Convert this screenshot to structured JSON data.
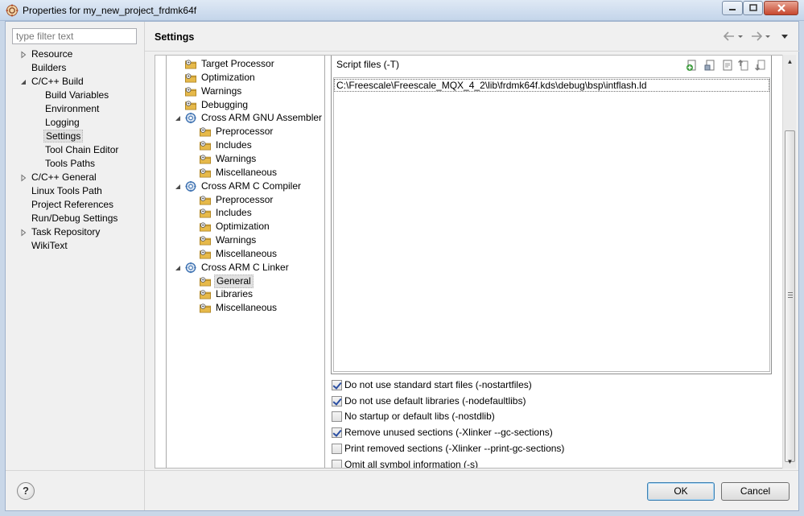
{
  "window": {
    "title": "Properties for my_new_project_frdmk64f",
    "controls": [
      "minimize",
      "maximize",
      "close"
    ]
  },
  "filter": {
    "placeholder": "type filter text"
  },
  "nav": {
    "items": [
      {
        "label": "Resource",
        "level": 0,
        "twisty": "collapsed"
      },
      {
        "label": "Builders",
        "level": 0,
        "twisty": "none"
      },
      {
        "label": "C/C++ Build",
        "level": 0,
        "twisty": "expanded"
      },
      {
        "label": "Build Variables",
        "level": 1,
        "twisty": "none"
      },
      {
        "label": "Environment",
        "level": 1,
        "twisty": "none"
      },
      {
        "label": "Logging",
        "level": 1,
        "twisty": "none"
      },
      {
        "label": "Settings",
        "level": 1,
        "twisty": "none",
        "selected": true
      },
      {
        "label": "Tool Chain Editor",
        "level": 1,
        "twisty": "none"
      },
      {
        "label": "Tools Paths",
        "level": 1,
        "twisty": "none"
      },
      {
        "label": "C/C++ General",
        "level": 0,
        "twisty": "collapsed"
      },
      {
        "label": "Linux Tools Path",
        "level": 0,
        "twisty": "none"
      },
      {
        "label": "Project References",
        "level": 0,
        "twisty": "none"
      },
      {
        "label": "Run/Debug Settings",
        "level": 0,
        "twisty": "none"
      },
      {
        "label": "Task Repository",
        "level": 0,
        "twisty": "collapsed"
      },
      {
        "label": "WikiText",
        "level": 0,
        "twisty": "none"
      }
    ]
  },
  "header": {
    "title": "Settings",
    "nav_icons": [
      "back-arrow-icon",
      "dropdown-icon",
      "forward-arrow-icon",
      "dropdown-icon",
      "view-menu-icon"
    ]
  },
  "tool_tree": {
    "items": [
      {
        "label": "Target Processor",
        "level": 0,
        "icon": "settings-folder-icon"
      },
      {
        "label": "Optimization",
        "level": 0,
        "icon": "settings-folder-icon"
      },
      {
        "label": "Warnings",
        "level": 0,
        "icon": "settings-folder-icon"
      },
      {
        "label": "Debugging",
        "level": 0,
        "icon": "settings-folder-icon"
      },
      {
        "label": "Cross ARM GNU Assembler",
        "level": 0,
        "icon": "tool-gear-icon",
        "twisty": "expanded"
      },
      {
        "label": "Preprocessor",
        "level": 1,
        "icon": "settings-folder-icon"
      },
      {
        "label": "Includes",
        "level": 1,
        "icon": "settings-folder-icon"
      },
      {
        "label": "Warnings",
        "level": 1,
        "icon": "settings-folder-icon"
      },
      {
        "label": "Miscellaneous",
        "level": 1,
        "icon": "settings-folder-icon"
      },
      {
        "label": "Cross ARM C Compiler",
        "level": 0,
        "icon": "tool-gear-icon",
        "twisty": "expanded"
      },
      {
        "label": "Preprocessor",
        "level": 1,
        "icon": "settings-folder-icon"
      },
      {
        "label": "Includes",
        "level": 1,
        "icon": "settings-folder-icon"
      },
      {
        "label": "Optimization",
        "level": 1,
        "icon": "settings-folder-icon"
      },
      {
        "label": "Warnings",
        "level": 1,
        "icon": "settings-folder-icon"
      },
      {
        "label": "Miscellaneous",
        "level": 1,
        "icon": "settings-folder-icon"
      },
      {
        "label": "Cross ARM C Linker",
        "level": 0,
        "icon": "tool-gear-icon",
        "twisty": "expanded"
      },
      {
        "label": "General",
        "level": 1,
        "icon": "settings-folder-icon",
        "selected": true
      },
      {
        "label": "Libraries",
        "level": 1,
        "icon": "settings-folder-icon"
      },
      {
        "label": "Miscellaneous",
        "level": 1,
        "icon": "settings-folder-icon"
      }
    ]
  },
  "script_files": {
    "label": "Script files (-T)",
    "toolbar_icons": [
      "add-icon",
      "add-workspace-icon",
      "edit-icon",
      "move-up-icon",
      "move-down-icon"
    ],
    "entries": [
      "C:\\Freescale\\Freescale_MQX_4_2\\lib\\frdmk64f.kds\\debug\\bsp\\intflash.ld"
    ]
  },
  "options": [
    {
      "label": "Do not use standard start files (-nostartfiles)",
      "checked": true
    },
    {
      "label": "Do not use default libraries (-nodefaultlibs)",
      "checked": true
    },
    {
      "label": "No startup or default libs (-nostdlib)",
      "checked": false
    },
    {
      "label": "Remove unused sections (-Xlinker --gc-sections)",
      "checked": true
    },
    {
      "label": "Print removed sections (-Xlinker --print-gc-sections)",
      "checked": false
    },
    {
      "label": "Omit all symbol information (-s)",
      "checked": false
    }
  ],
  "buttons": {
    "help": "?",
    "ok": "OK",
    "cancel": "Cancel"
  },
  "colors": {
    "title_bg": "#c4d5ea",
    "panel_bg": "#f0f0f0",
    "folder": "#e6b94a",
    "gear": "#3a6fb0"
  }
}
